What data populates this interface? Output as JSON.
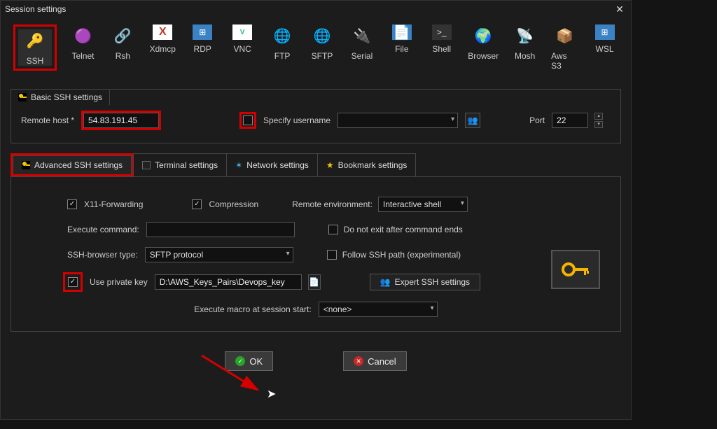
{
  "window": {
    "title": "Session settings",
    "close": "✕"
  },
  "protocols": {
    "ssh": "SSH",
    "telnet": "Telnet",
    "rsh": "Rsh",
    "xdmcp": "Xdmcp",
    "rdp": "RDP",
    "vnc": "VNC",
    "ftp": "FTP",
    "sftp": "SFTP",
    "serial": "Serial",
    "file": "File",
    "shell": "Shell",
    "browser": "Browser",
    "mosh": "Mosh",
    "awss3": "Aws S3",
    "wsl": "WSL"
  },
  "basic": {
    "group_title": "Basic SSH settings",
    "remote_host_label": "Remote host *",
    "remote_host_value": "54.83.191.45",
    "specify_username_label": "Specify username",
    "username_value": "",
    "port_label": "Port",
    "port_value": "22"
  },
  "tabs": {
    "advanced": "Advanced SSH settings",
    "terminal": "Terminal settings",
    "network": "Network settings",
    "bookmark": "Bookmark settings"
  },
  "advanced": {
    "x11_label": "X11-Forwarding",
    "compression_label": "Compression",
    "remote_env_label": "Remote environment:",
    "remote_env_value": "Interactive shell",
    "exec_cmd_label": "Execute command:",
    "exec_cmd_value": "",
    "dont_exit_label": "Do not exit after command ends",
    "ssh_browser_label": "SSH-browser type:",
    "ssh_browser_value": "SFTP protocol",
    "follow_path_label": "Follow SSH path (experimental)",
    "use_pkey_label": "Use private key",
    "pkey_path_value": "D:\\AWS_Keys_Pairs\\Devops_key",
    "expert_btn": "Expert SSH settings",
    "macro_label": "Execute macro at session start:",
    "macro_value": "<none>"
  },
  "buttons": {
    "ok": "OK",
    "cancel": "Cancel"
  }
}
